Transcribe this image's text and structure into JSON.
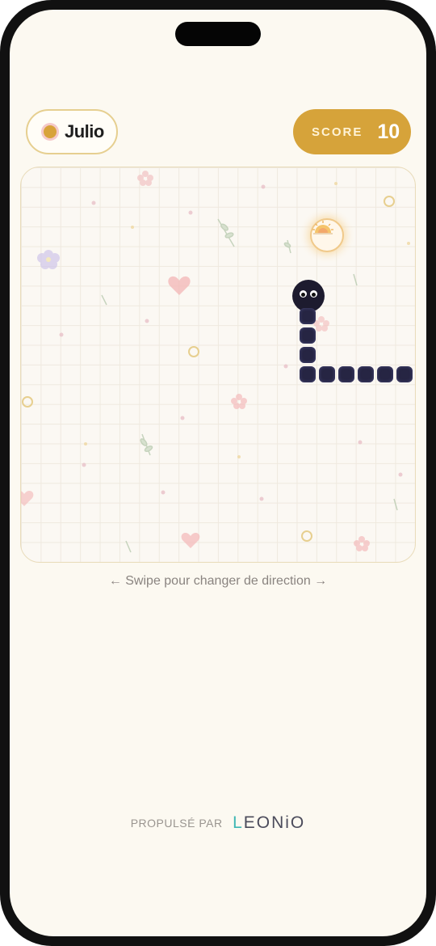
{
  "player": {
    "name": "Julio"
  },
  "score": {
    "label": "SCORE",
    "value": "10"
  },
  "game": {
    "food_icon": "sun-rising-icon",
    "snake_color": "#1d1b2f",
    "accent_color": "#d6a33a"
  },
  "hint": "← Swipe pour changer de direction →",
  "footer": {
    "powered_by": "PROPULSÉ PAR",
    "brand_l": "L",
    "brand_rest": "EONiO"
  }
}
